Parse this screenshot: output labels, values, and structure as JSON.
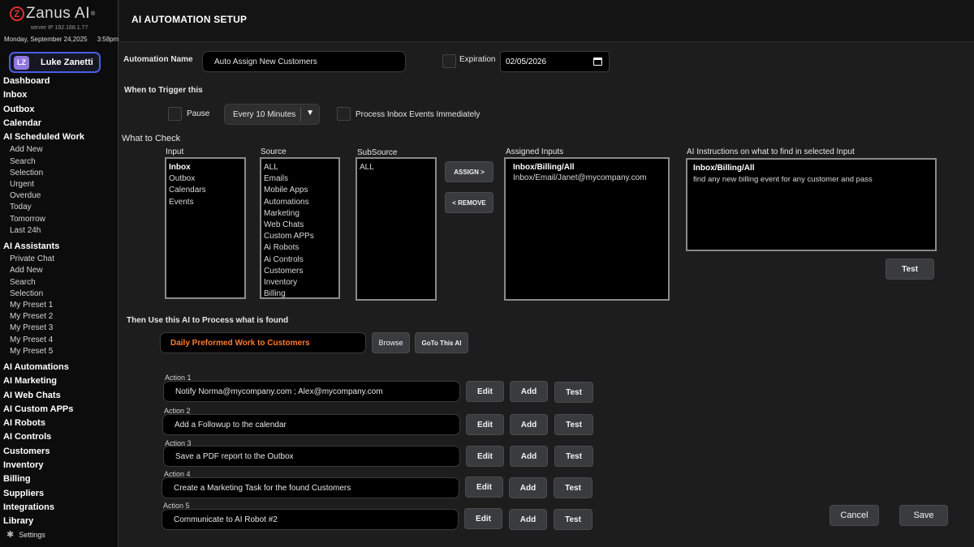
{
  "app": {
    "logo_text": "Zanus AI",
    "logo_mark": "Z",
    "trademark": "®",
    "server": "server IP 192.168.1.77",
    "date": "Monday, September 24,2025",
    "time": "3:58pm",
    "user": {
      "initials": "LZ",
      "name": "Luke Zanetti"
    },
    "settings_label": "Settings",
    "settings_icon": "gear-icon"
  },
  "nav": {
    "dashboard": "Dashboard",
    "inbox": "Inbox",
    "outbox": "Outbox",
    "calendar": "Calendar",
    "ai_scheduled_work": "AI Scheduled Work",
    "scheduled_items": [
      "Add New",
      "Search",
      "Selection",
      "Urgent",
      "Overdue",
      "Today",
      "Tomorrow",
      "Last 24h"
    ],
    "ai_assistants": "AI Assistants",
    "assistant_items": [
      "Private Chat",
      "Add New",
      "Search",
      "Selection",
      "My Preset 1",
      "My Preset 2",
      "My Preset 3",
      "My Preset 4",
      "My Preset 5"
    ],
    "bottom": [
      "AI Automations",
      "AI Marketing",
      "AI Web Chats",
      "AI Custom APPs",
      "AI Robots",
      "AI Controls",
      "Customers",
      "Inventory",
      "Billing",
      "Suppliers",
      "Integrations",
      "Library"
    ]
  },
  "page": {
    "title": "AI AUTOMATION SETUP",
    "automation_name_label": "Automation Name",
    "automation_name_value": "Auto Assign New Customers",
    "expiration_label": "Expiration",
    "expiration_value": "02/05/2026",
    "trigger_heading": "When to Trigger this",
    "pause_label": "Pause",
    "interval_value": "Every 10 Minutes",
    "interval_arrow": "▼",
    "process_immediately_label": "Process Inbox Events Immediately",
    "check_heading": "What to Check",
    "input_label": "Input",
    "input_items": [
      "Inbox",
      "Outbox",
      "Calendars",
      "Events"
    ],
    "source_label": "Source",
    "source_items": [
      "ALL",
      "Emails",
      "Mobile Apps",
      "Automations",
      "Marketing",
      "Web Chats",
      "Custom APPs",
      "Ai Robots",
      "Ai Controls",
      "Customers",
      "Inventory",
      "Billing"
    ],
    "subsource_label": "SubSource",
    "subsource_items": [
      "ALL"
    ],
    "assign_button": "ASSIGN >",
    "remove_button": "< REMOVE",
    "assigned_label": "Assigned Inputs",
    "assigned_items": [
      "Inbox/Billing/All",
      "Inbox/Email/Janet@mycompany.com"
    ],
    "instructions_label": "AI Instructions on what to find in selected Input",
    "instructions_title": "Inbox/Billing/All",
    "instructions_text": "find any new billing event for any customer and pass",
    "test_button": "Test",
    "process_heading": "Then Use this AI to Process what is found",
    "ai_value": "Daily Preformed Work to Customers",
    "browse_button": "Browse",
    "goto_button": "GoTo This AI",
    "actions": [
      {
        "label": "Action 1",
        "value": "Notify  Norma@mycompany.com ; Alex@mycompany.com",
        "edit": "Edit",
        "add": "Add",
        "test": "Test"
      },
      {
        "label": "Action 2",
        "value": "Add a Followup to the calendar",
        "edit": "Edit",
        "add": "Add",
        "test": "Test"
      },
      {
        "label": "Action 3",
        "value": "Save a PDF report to the Outbox",
        "edit": "Edit",
        "add": "Add",
        "test": "Test"
      },
      {
        "label": "Action 4",
        "value": "Create a Marketing Task for the found Customers",
        "edit": "Edit",
        "add": "Add",
        "test": "Test"
      },
      {
        "label": "Action 5",
        "value": "Communicate to AI Robot #2",
        "edit": "Edit",
        "add": "Add",
        "test": "Test"
      }
    ],
    "cancel_button": "Cancel",
    "save_button": "Save"
  }
}
